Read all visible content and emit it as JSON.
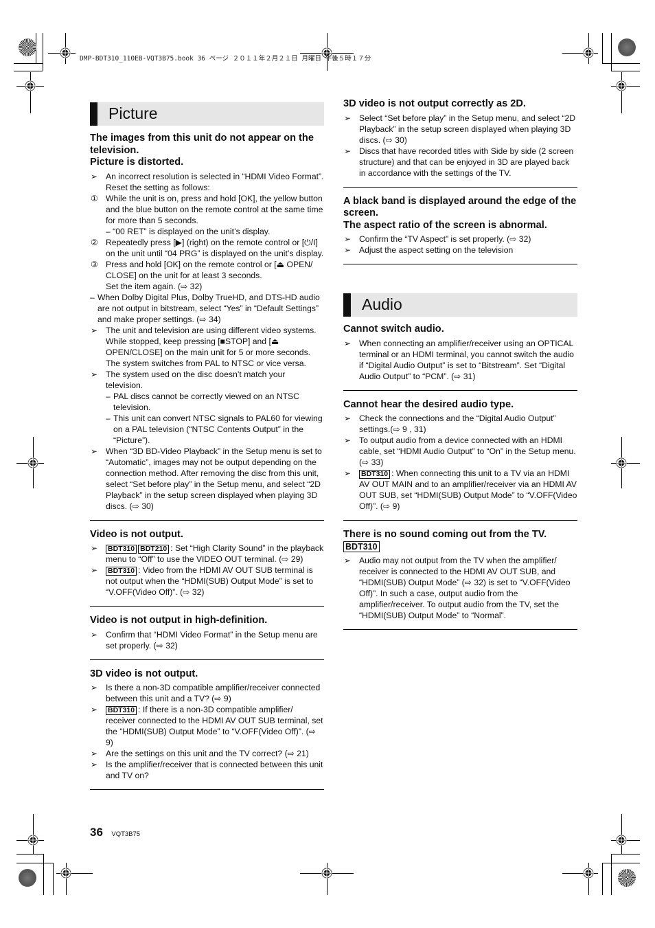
{
  "print_header": "DMP-BDT310_110EB-VQT3B75.book  36 ページ  ２０１１年２月２１日  月曜日  午後５時１７分",
  "icons": {
    "registration_mark": "registration-crosshair-icon",
    "color_bar_disc": "color-disc-icon",
    "bullet": "arrow-bullet-icon",
    "page_ref": "page-reference-arrow-icon"
  },
  "left_column": {
    "section_title": "Picture",
    "topics": [
      {
        "title_lines": [
          "The images from this unit do not appear on the television.",
          "Picture is distorted."
        ],
        "items": [
          {
            "marker": "➢",
            "text": "An incorrect resolution is selected in “HDMI Video Format”. Reset the setting as follows:"
          },
          {
            "marker": "①",
            "text": "While the unit is on, press and hold [OK], the yellow button and the blue button on the remote control at the same time for more than 5 seconds."
          },
          {
            "marker": "",
            "text": "– “00 RET” is displayed on the unit’s display."
          },
          {
            "marker": "②",
            "text": "Repeatedly press [▶] (right) on the remote control or [⏻/I] on the unit until “04 PRG” is displayed on the unit’s display."
          },
          {
            "marker": "③",
            "text": "Press and hold [OK] on the remote control or [⏏ OPEN/ CLOSE] on the unit for at least 3 seconds."
          },
          {
            "marker": "",
            "text": "Set the item again. (⇨ 32)"
          },
          {
            "marker": "–",
            "text": "When Dolby Digital Plus, Dolby TrueHD, and DTS-HD audio are not output in bitstream, select “Yes” in “Default Settings” and make proper settings. (⇨ 34)"
          },
          {
            "marker": "➢",
            "text": "The unit and television are using different video systems. While stopped, keep pressing [■STOP] and [⏏ OPEN/CLOSE] on the main unit for 5 or more seconds. The system switches from PAL to NTSC or vice versa."
          },
          {
            "marker": "➢",
            "text": "The system used on the disc doesn’t match your television."
          },
          {
            "marker": "–",
            "text": "PAL discs cannot be correctly viewed on an NTSC television."
          },
          {
            "marker": "–",
            "text": "This unit can convert NTSC signals to PAL60 for viewing on a PAL television (“NTSC Contents Output” in the “Picture”)."
          },
          {
            "marker": "➢",
            "text": "When “3D BD-Video Playback” in the Setup menu is set to “Automatic”, images may not be output depending on the connection method. After removing the disc from this unit, select “Set before play” in the Setup menu, and select “2D Playback” in the setup screen displayed when playing 3D discs. (⇨ 30)"
          }
        ]
      },
      {
        "title": "Video is not output.",
        "items": [
          {
            "marker": "➢",
            "badges": [
              "BDT310",
              "BDT210"
            ],
            "text": ": Set “High Clarity Sound” in the playback menu to “Off” to use the VIDEO OUT terminal. (⇨ 29)"
          },
          {
            "marker": "➢",
            "badges": [
              "BDT310"
            ],
            "text": ": Video from the HDMI AV OUT SUB terminal is not output when the “HDMI(SUB) Output Mode” is set to “V.OFF(Video Off)”. (⇨ 32)"
          }
        ]
      },
      {
        "title": "Video is not output in high-definition.",
        "items": [
          {
            "marker": "➢",
            "text": "Confirm that “HDMI Video Format” in the Setup menu are set properly. (⇨ 32)"
          }
        ]
      },
      {
        "title": "3D video is not output.",
        "items": [
          {
            "marker": "➢",
            "text": "Is there a non-3D compatible amplifier/receiver connected between this unit and a TV? (⇨ 9)"
          },
          {
            "marker": "➢",
            "badges": [
              "BDT310"
            ],
            "text": ": If there is a non-3D compatible amplifier/ receiver connected to the HDMI AV OUT SUB terminal, set the “HDMI(SUB) Output Mode” to “V.OFF(Video Off)”. (⇨ 9)"
          },
          {
            "marker": "➢",
            "text": "Are the settings on this unit and the TV correct? (⇨ 21)"
          },
          {
            "marker": "➢",
            "text": "Is the amplifier/receiver that is connected between this unit and TV on?"
          }
        ]
      }
    ]
  },
  "right_column": {
    "topics_top": [
      {
        "title": "3D video is not output correctly as 2D.",
        "items": [
          {
            "marker": "➢",
            "text": "Select “Set before play” in the Setup menu, and select “2D Playback” in the setup screen displayed when playing 3D discs. (⇨ 30)"
          },
          {
            "marker": "➢",
            "text": "Discs that have recorded titles with Side by side (2 screen structure) and that can be enjoyed in 3D are played back in accordance with the settings of the TV."
          }
        ]
      },
      {
        "title_lines": [
          "A black band is displayed around the edge of the screen.",
          "The aspect ratio of the screen is abnormal."
        ],
        "items": [
          {
            "marker": "➢",
            "text": "Confirm the “TV Aspect” is set properly. (⇨ 32)"
          },
          {
            "marker": "➢",
            "text": "Adjust the aspect setting on the television"
          }
        ]
      }
    ],
    "section_title": "Audio",
    "topics_audio": [
      {
        "title": "Cannot switch audio.",
        "items": [
          {
            "marker": "➢",
            "text": "When connecting an amplifier/receiver using an OPTICAL terminal or an HDMI terminal, you cannot switch the audio if “Digital Audio Output” is set to “Bitstream”. Set “Digital Audio Output” to “PCM”. (⇨ 31)"
          }
        ]
      },
      {
        "title": "Cannot hear the desired audio type.",
        "items": [
          {
            "marker": "➢",
            "text": "Check the connections and the “Digital Audio Output” settings.(⇨ 9 , 31)"
          },
          {
            "marker": "➢",
            "text": "To output audio from a device connected with an HDMI cable, set “HDMI Audio Output” to “On” in the Setup menu. (⇨ 33)"
          },
          {
            "marker": "➢",
            "badges": [
              "BDT310"
            ],
            "text": ": When connecting this unit to a TV via an HDMI AV OUT MAIN and to an amplifier/receiver via an HDMI AV OUT SUB, set “HDMI(SUB) Output Mode” to “V.OFF(Video Off)”. (⇨ 9)"
          }
        ]
      },
      {
        "title": "There is no sound coming out from the TV.",
        "title_badge": "BDT310",
        "items": [
          {
            "marker": "➢",
            "text": "Audio may not output from the TV when the amplifier/ receiver is connected to the HDMI AV OUT SUB, and “HDMI(SUB) Output Mode” (⇨ 32) is set to “V.OFF(Video Off)”. In such a case, output audio from the amplifier/receiver. To output audio from the TV, set the “HDMI(SUB) Output Mode” to “Normal”."
          }
        ]
      }
    ]
  },
  "footer": {
    "page_number": "36",
    "doc_code": "VQT3B75"
  }
}
